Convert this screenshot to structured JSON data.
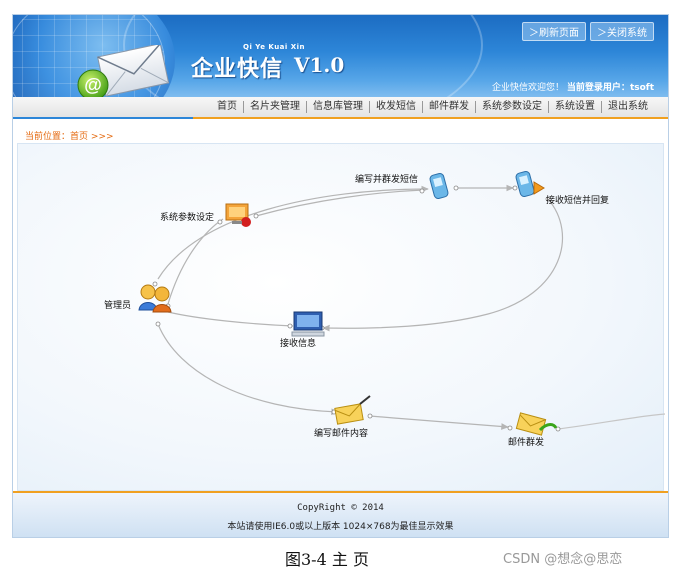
{
  "header": {
    "pinyin": "Qi Ye Kuai Xin",
    "brand": "企业快信",
    "version": "V1.0",
    "top_links": [
      "＞刷新页面",
      "＞关闭系统"
    ],
    "welcome": "企业快信欢迎您！",
    "current_user_label": "当前登录用户：",
    "current_user": "tsoft"
  },
  "nav": {
    "items": [
      "首页",
      "名片夹管理",
      "信息库管理",
      "收发短信",
      "邮件群发",
      "系统参数设定",
      "系统设置",
      "退出系统"
    ]
  },
  "breadcrumb": {
    "label": "当前位置：",
    "home": "首页",
    "arrows": ">>>"
  },
  "diagram": {
    "nodes": {
      "admin": "管理员",
      "params": "系统参数设定",
      "write_sms": "编写并群发短信",
      "receive_sms": "接收短信并回复",
      "receive_info": "接收信息",
      "write_mail": "编写邮件内容",
      "mass_mail": "邮件群发"
    },
    "colors": {
      "line": "#b5b5b5",
      "accent": "#e46a10"
    }
  },
  "footer": {
    "copyright": "CopyRight © 2014",
    "best_view": "本站请使用IE6.0或以上版本 1024×768为最佳显示效果"
  },
  "caption": "图3-4  主  页",
  "watermark": "CSDN @想念@思恋"
}
